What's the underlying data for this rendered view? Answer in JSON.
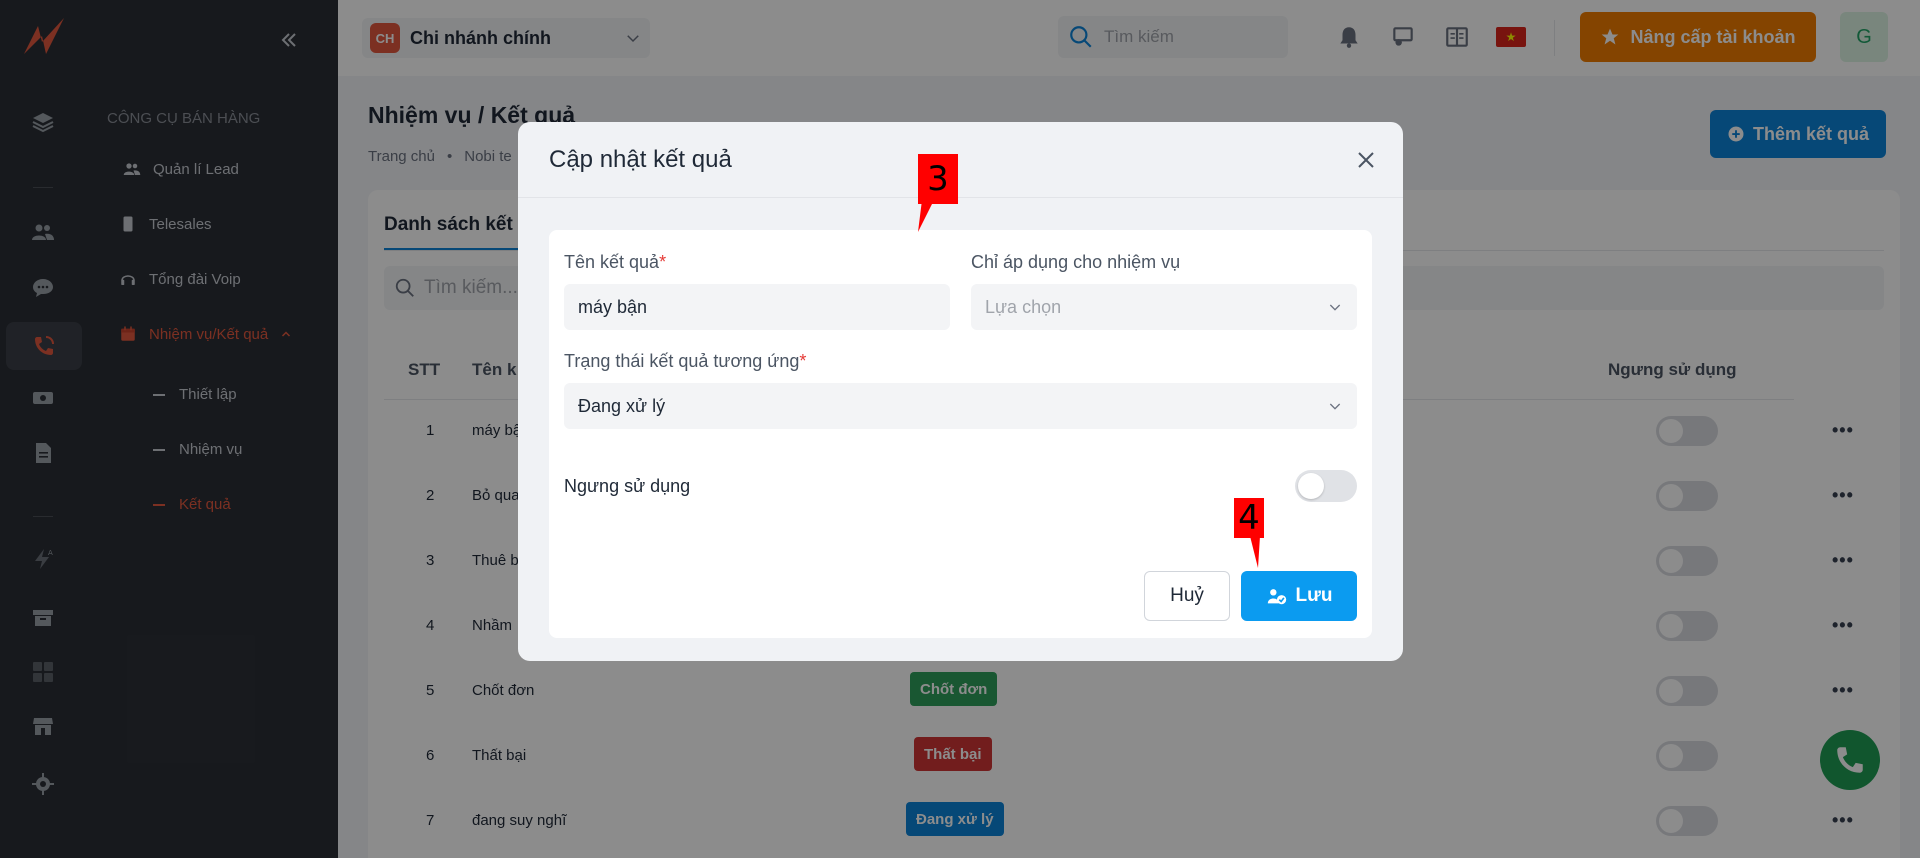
{
  "subbar": {
    "section": "CÔNG CỤ BÁN HÀNG",
    "items": [
      {
        "label": "Quản lí Lead"
      },
      {
        "label": "Telesales"
      },
      {
        "label": "Tổng đài Voip"
      },
      {
        "label": "Nhiệm vụ/Kết quả"
      }
    ],
    "subitems": [
      {
        "label": "Thiết lập"
      },
      {
        "label": "Nhiệm vụ"
      },
      {
        "label": "Kết quả"
      }
    ]
  },
  "topbar": {
    "branch_badge": "CH",
    "branch_name": "Chi nhánh chính",
    "search_placeholder": "Tìm kiếm",
    "upgrade_label": "Nâng cấp tài khoản",
    "avatar_letter": "G"
  },
  "page": {
    "title": "Nhiệm vụ / Kết quả",
    "breadcrumb_home": "Trang chủ",
    "breadcrumb_sep": "•",
    "breadcrumb_next": "Nobi te",
    "add_button": "Thêm kết quả",
    "tab": "Danh sách kết",
    "filter_placeholder": "Tìm kiếm...",
    "columns": {
      "stt": "STT",
      "name": "Tên k",
      "disabled": "Ngưng sử dụng"
    }
  },
  "rows": [
    {
      "stt": "1",
      "name": "máy bận",
      "tag": ""
    },
    {
      "stt": "2",
      "name": "Bỏ qua",
      "tag": ""
    },
    {
      "stt": "3",
      "name": "Thuê b",
      "tag": ""
    },
    {
      "stt": "4",
      "name": "Nhầm",
      "tag": ""
    },
    {
      "stt": "5",
      "name": "Chốt đơn",
      "tag": "Chốt đơn"
    },
    {
      "stt": "6",
      "name": "Thất bại",
      "tag": "Thất bại"
    },
    {
      "stt": "7",
      "name": "đang suy nghĩ",
      "tag": "Đang xử lý"
    }
  ],
  "colors": {
    "tag_success": "#2e9e5b",
    "tag_danger": "#d03636",
    "tag_info": "#0b83d9"
  },
  "modal": {
    "title": "Cập nhật kết quả",
    "name_label": "Tên kết quả",
    "name_value": "máy bận",
    "apply_label": "Chỉ áp dụng cho nhiệm vụ",
    "apply_placeholder": "Lựa chọn",
    "status_label": "Trạng thái kết quả tương ứng",
    "status_value": "Đang xử lý",
    "disabled_label": "Ngưng sử dụng",
    "cancel_label": "Huỷ",
    "save_label": "Lưu",
    "required_mark": "*"
  },
  "annotations": [
    "3",
    "4"
  ]
}
